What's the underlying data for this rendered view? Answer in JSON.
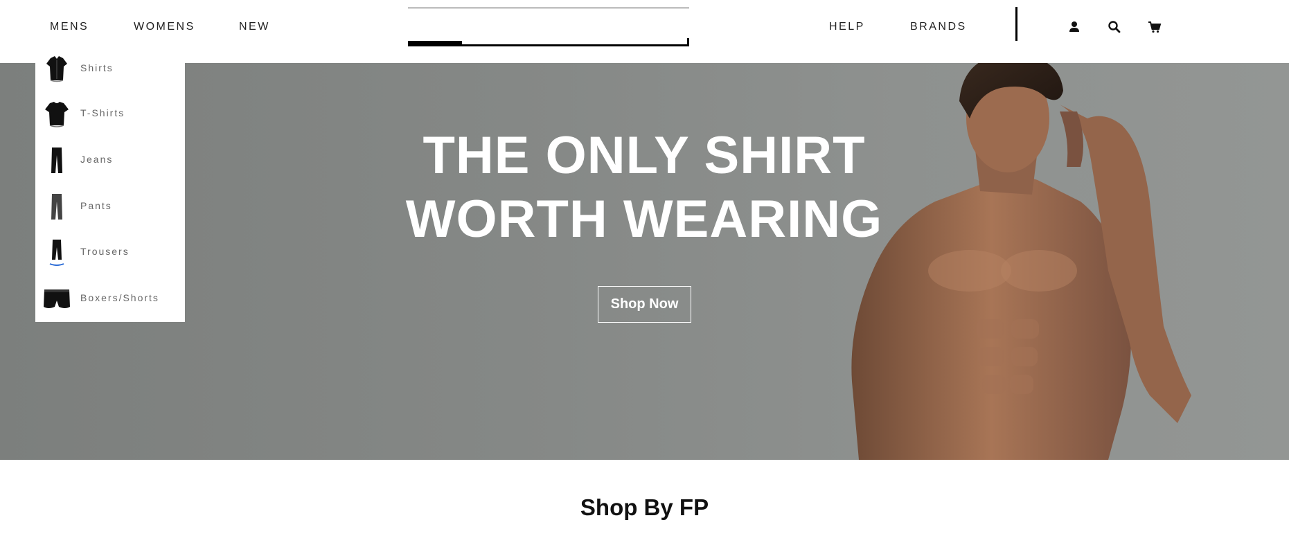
{
  "nav": {
    "left": [
      {
        "label": "MENS"
      },
      {
        "label": "WOMENS"
      },
      {
        "label": "NEW"
      }
    ],
    "right": [
      {
        "label": "HELP"
      },
      {
        "label": "BRANDS"
      }
    ],
    "icons": [
      "user-icon",
      "search-icon",
      "cart-icon"
    ]
  },
  "dropdown": {
    "items": [
      {
        "label": "Shirts",
        "icon": "shirt-icon"
      },
      {
        "label": "T-Shirts",
        "icon": "tshirt-icon"
      },
      {
        "label": "Jeans",
        "icon": "jeans-icon"
      },
      {
        "label": "Pants",
        "icon": "pants-icon"
      },
      {
        "label": "Trousers",
        "icon": "trousers-icon"
      },
      {
        "label": "Boxers/Shorts",
        "icon": "boxers-icon"
      }
    ]
  },
  "hero": {
    "title_line1": "THE ONLY SHIRT",
    "title_line2": "WORTH WEARING",
    "cta": "Shop Now"
  },
  "section": {
    "title": "Shop By FP"
  },
  "colors": {
    "hero_bg": "#858886",
    "text_dark": "#222222",
    "menu_text": "#666666",
    "white": "#ffffff"
  }
}
